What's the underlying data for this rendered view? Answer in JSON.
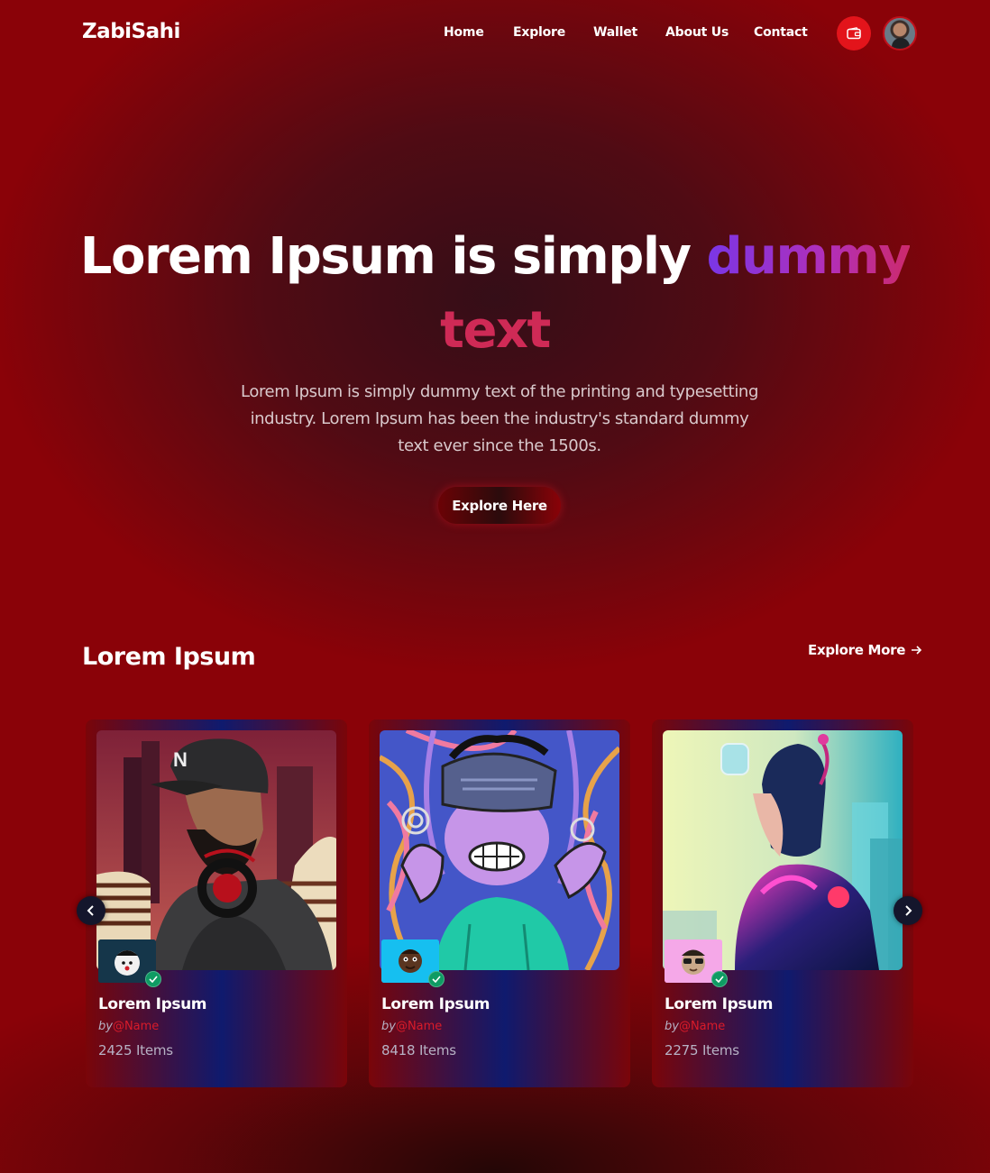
{
  "brand": {
    "logo": "ZabiSahi"
  },
  "nav": {
    "items": [
      "Home",
      "Explore",
      "Wallet",
      "About Us",
      "Contact"
    ],
    "wallet_icon": "wallet-icon",
    "avatar_icon": "user-avatar"
  },
  "hero": {
    "title_part1": "Lorem Ipsum is simply",
    "title_highlight_1": "dummy",
    "title_highlight_2": "text",
    "description": "Lorem Ipsum is simply dummy text of the printing and typesetting industry. Lorem Ipsum has been the industry's standard dummy text ever since the 1500s.",
    "cta_label": "Explore Here"
  },
  "collection": {
    "title": "Lorem Ipsum",
    "explore_more_label": "Explore More",
    "explore_more_icon": "arrow-right-icon",
    "prev_icon": "chevron-left-icon",
    "next_icon": "chevron-right-icon",
    "cards": [
      {
        "name": "Lorem Ipsum",
        "by_prefix": "by",
        "handle": "@Name",
        "items": "2425 Items",
        "artwork": "man-with-headphones-illustration",
        "verified_icon": "check-icon"
      },
      {
        "name": "Lorem Ipsum",
        "by_prefix": "by",
        "handle": "@Name",
        "items": "8418 Items",
        "artwork": "vr-headset-cartoon",
        "verified_icon": "check-icon"
      },
      {
        "name": "Lorem Ipsum",
        "by_prefix": "by",
        "handle": "@Name",
        "items": "2275 Items",
        "artwork": "cyberpunk-girl",
        "verified_icon": "check-icon"
      }
    ]
  },
  "colors": {
    "background": "#8a0208",
    "accent_red": "#e3141b",
    "purple": "#7a36e6",
    "verified_green": "#0f9b63",
    "card_blue": "#0f1a6e"
  }
}
